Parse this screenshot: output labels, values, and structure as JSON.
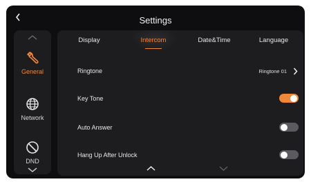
{
  "header": {
    "title": "Settings",
    "back_icon": "chevron-left-icon"
  },
  "sidebar": {
    "up_icon": "chevron-up-icon",
    "down_icon": "chevron-down-icon",
    "items": [
      {
        "label": "General",
        "icon": "wrench-icon",
        "active": true
      },
      {
        "label": "Network",
        "icon": "globe-icon",
        "active": false
      },
      {
        "label": "DND",
        "icon": "do-not-disturb-icon",
        "active": false
      }
    ]
  },
  "tabs": [
    {
      "label": "Display",
      "active": false
    },
    {
      "label": "Intercom",
      "active": true
    },
    {
      "label": "Date&Time",
      "active": false
    },
    {
      "label": "Language",
      "active": false
    }
  ],
  "settings": {
    "ringtone": {
      "label": "Ringtone",
      "value": "Ringtone 01"
    },
    "key_tone": {
      "label": "Key Tone",
      "enabled": true
    },
    "auto_answer": {
      "label": "Auto Answer",
      "enabled": false
    },
    "hang_up_after_unlock": {
      "label": "Hang Up After Unlock",
      "enabled": false
    }
  },
  "colors": {
    "accent": "#f0883a",
    "background": "#0e0e10",
    "panel": "#1d1d20",
    "toggle_off": "#5b5b5f"
  }
}
